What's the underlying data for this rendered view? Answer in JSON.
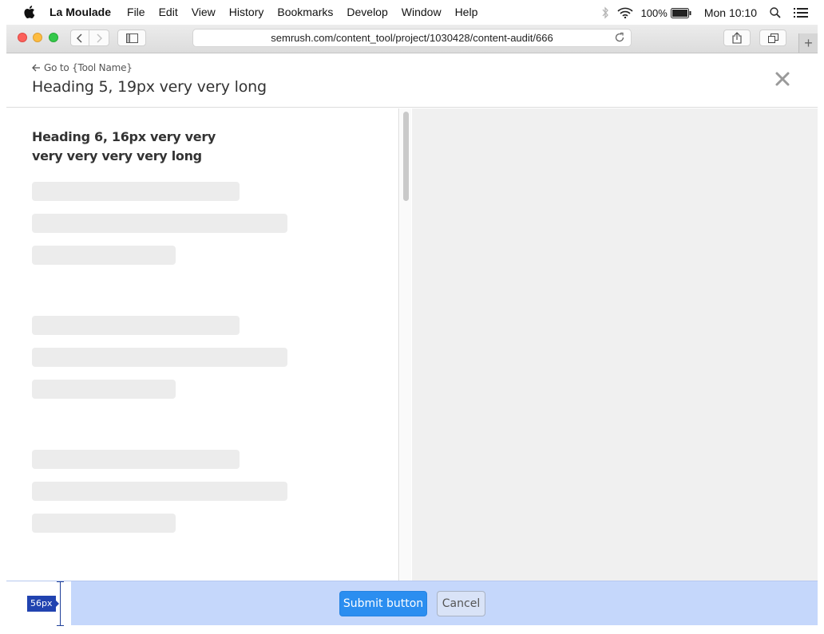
{
  "menubar": {
    "app_name": "La Moulade",
    "items": [
      "File",
      "Edit",
      "View",
      "History",
      "Bookmarks",
      "Develop",
      "Window",
      "Help"
    ],
    "battery": "100%",
    "clock": "Mon 10:10",
    "icons": [
      "apple-icon",
      "bluetooth-icon",
      "wifi-icon",
      "battery-icon",
      "search-icon",
      "list-icon"
    ]
  },
  "browser": {
    "url": "semrush.com/content_tool/project/1030428/content-audit/666"
  },
  "modal": {
    "back_link": "Go to {Tool Name}",
    "title": "Heading 5, 19px very very long",
    "panel_heading": "Heading 6, 16px very very very very very very long",
    "footer": {
      "measure_label": "56px",
      "submit_label": "Submit button",
      "cancel_label": "Cancel"
    }
  },
  "colors": {
    "primary": "#2b8ef0",
    "footer_bg": "#c5d7fb",
    "measure": "#2143b0",
    "skeleton": "#ececec"
  }
}
